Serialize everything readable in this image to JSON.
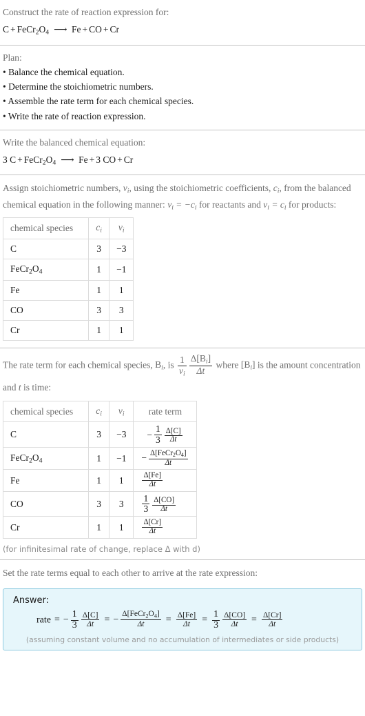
{
  "prompt": {
    "title": "Construct the rate of reaction expression for:",
    "equation": {
      "reactants": [
        "C",
        "FeCr2O4"
      ],
      "products": [
        "Fe",
        "CO",
        "Cr"
      ],
      "arrow": "⟶",
      "text": "C + FeCr_2O_4 ⟶ Fe + CO + Cr"
    }
  },
  "plan": {
    "heading": "Plan:",
    "steps": [
      "Balance the chemical equation.",
      "Determine the stoichiometric numbers.",
      "Assemble the rate term for each chemical species.",
      "Write the rate of reaction expression."
    ]
  },
  "balanced": {
    "heading": "Write the balanced chemical equation:",
    "text": "3 C + FeCr_2O_4 ⟶ Fe + 3 CO + Cr",
    "reactant_coeffs": [
      "3",
      ""
    ],
    "product_coeffs": [
      "",
      "3",
      ""
    ]
  },
  "stoich": {
    "intro_1": "Assign stoichiometric numbers, ",
    "intro_2": ", using the stoichiometric coefficients, ",
    "intro_3": ", from the balanced chemical equation in the following manner: ",
    "intro_4": " for reactants and ",
    "intro_5": " for products:",
    "nu_symbol": "ν",
    "c_symbol": "c",
    "rel_reactants": "ν_i = −c_i",
    "rel_products": "ν_i = c_i",
    "table": {
      "headers": [
        "chemical species",
        "c_i",
        "ν_i"
      ],
      "rows": [
        {
          "species": "C",
          "species_sub": "",
          "c": "3",
          "nu": "−3"
        },
        {
          "species": "FeCr2O4",
          "species_sub": "",
          "c": "1",
          "nu": "−1"
        },
        {
          "species": "Fe",
          "species_sub": "",
          "c": "1",
          "nu": "1"
        },
        {
          "species": "CO",
          "species_sub": "",
          "c": "3",
          "nu": "3"
        },
        {
          "species": "Cr",
          "species_sub": "",
          "c": "1",
          "nu": "1"
        }
      ]
    }
  },
  "rateterm": {
    "intro_1": "The rate term for each chemical species, ",
    "b_symbol": "B",
    "intro_2": ", is ",
    "formula": "1/ν_i · Δ[B_i]/Δt",
    "intro_3": " where ",
    "bracket_b": "[B_i]",
    "intro_4": " is the amount concentration and ",
    "t_symbol": "t",
    "intro_5": " is time:",
    "table": {
      "headers": [
        "chemical species",
        "c_i",
        "ν_i",
        "rate term"
      ],
      "rows": [
        {
          "species": "C",
          "c": "3",
          "nu": "−3",
          "sign": "−",
          "coeff_num": "1",
          "coeff_den": "3",
          "delta_num": "Δ[C]",
          "delta_den": "Δt",
          "style": "coeff"
        },
        {
          "species": "FeCr2O4",
          "c": "1",
          "nu": "−1",
          "sign": "−",
          "coeff_num": "",
          "coeff_den": "",
          "delta_num": "Δ[FeCr2O4]",
          "delta_den": "Δt",
          "style": "plain"
        },
        {
          "species": "Fe",
          "c": "1",
          "nu": "1",
          "sign": "",
          "coeff_num": "",
          "coeff_den": "",
          "delta_num": "Δ[Fe]",
          "delta_den": "Δt",
          "style": "plain"
        },
        {
          "species": "CO",
          "c": "3",
          "nu": "3",
          "sign": "",
          "coeff_num": "1",
          "coeff_den": "3",
          "delta_num": "Δ[CO]",
          "delta_den": "Δt",
          "style": "coeff"
        },
        {
          "species": "Cr",
          "c": "1",
          "nu": "1",
          "sign": "",
          "coeff_num": "",
          "coeff_den": "",
          "delta_num": "Δ[Cr]",
          "delta_den": "Δt",
          "style": "plain"
        }
      ]
    },
    "footnote": "(for infinitesimal rate of change, replace Δ with d)"
  },
  "final": {
    "heading": "Set the rate terms equal to each other to arrive at the rate expression:",
    "answer_label": "Answer:",
    "rate_word": "rate",
    "equals": "=",
    "expression_text": "rate = −(1/3)Δ[C]/Δt = −Δ[FeCr2O4]/Δt = Δ[Fe]/Δt = (1/3)Δ[CO]/Δt = Δ[Cr]/Δt",
    "terms": [
      {
        "sign": "−",
        "coeff_num": "1",
        "coeff_den": "3",
        "delta_num": "Δ[C]",
        "delta_den": "Δt"
      },
      {
        "sign": "−",
        "coeff_num": "",
        "coeff_den": "",
        "delta_num": "Δ[FeCr2O4]",
        "delta_den": "Δt"
      },
      {
        "sign": "",
        "coeff_num": "",
        "coeff_den": "",
        "delta_num": "Δ[Fe]",
        "delta_den": "Δt"
      },
      {
        "sign": "",
        "coeff_num": "1",
        "coeff_den": "3",
        "delta_num": "Δ[CO]",
        "delta_den": "Δt"
      },
      {
        "sign": "",
        "coeff_num": "",
        "coeff_den": "",
        "delta_num": "Δ[Cr]",
        "delta_den": "Δt"
      }
    ],
    "assumption": "(assuming constant volume and no accumulation of intermediates or side products)"
  },
  "colors": {
    "answer_bg": "#e6f6fb",
    "answer_border": "#8fcbe0",
    "rule": "#c3c3c3",
    "table_border": "#dcdcdc",
    "muted_text": "#6e6e6e",
    "body_text": "#1a1a1a"
  }
}
